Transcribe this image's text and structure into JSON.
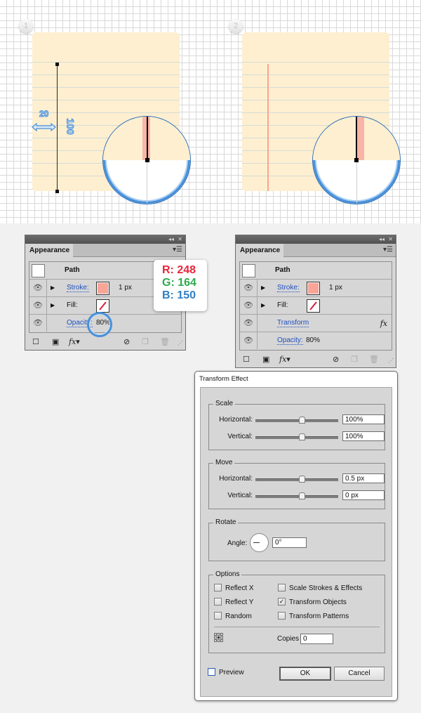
{
  "steps": [
    {
      "number": "1",
      "annotations": {
        "width_label": "20",
        "height_label": "100"
      }
    },
    {
      "number": "2"
    }
  ],
  "color_callout": {
    "r": "R: 248",
    "g": "G: 164",
    "b": "B: 150",
    "hex": "#f8a496"
  },
  "appearance_panels": [
    {
      "tab": "Appearance",
      "object_label": "Path",
      "rows": [
        {
          "type": "stroke",
          "label": "Stroke:",
          "value": "1 px"
        },
        {
          "type": "fill",
          "label": "Fill:"
        },
        {
          "type": "opacity",
          "label": "Opacity:",
          "value": "80%"
        }
      ]
    },
    {
      "tab": "Appearance",
      "object_label": "Path",
      "rows": [
        {
          "type": "stroke",
          "label": "Stroke:",
          "value": "1 px"
        },
        {
          "type": "fill",
          "label": "Fill:"
        },
        {
          "type": "effect",
          "label": "Transform",
          "icon": "fx"
        },
        {
          "type": "opacity",
          "label": "Opacity:",
          "value": "80%"
        }
      ]
    }
  ],
  "panel_icons": {
    "fx": "fx",
    "fx_menu": "fx▾"
  },
  "transform_dialog": {
    "title": "Transform Effect",
    "scale": {
      "label": "Scale",
      "horizontal_label": "Horizontal:",
      "horizontal": "100%",
      "vertical_label": "Vertical:",
      "vertical": "100%"
    },
    "move": {
      "label": "Move",
      "horizontal_label": "Horizontal:",
      "horizontal": "0.5 px",
      "vertical_label": "Vertical:",
      "vertical": "0 px"
    },
    "rotate": {
      "label": "Rotate",
      "angle_label": "Angle:",
      "angle": "0°"
    },
    "options": {
      "label": "Options",
      "reflect_x": {
        "label": "Reflect X",
        "checked": false
      },
      "reflect_y": {
        "label": "Reflect Y",
        "checked": false
      },
      "random": {
        "label": "Random",
        "checked": false
      },
      "scale_strokes": {
        "label": "Scale Strokes & Effects",
        "checked": false
      },
      "transform_objects": {
        "label": "Transform Objects",
        "checked": true
      },
      "transform_patterns": {
        "label": "Transform Patterns",
        "checked": false
      },
      "copies_label": "Copies",
      "copies": "0"
    },
    "preview": {
      "label": "Preview",
      "checked": false
    },
    "ok_label": "OK",
    "cancel_label": "Cancel"
  }
}
